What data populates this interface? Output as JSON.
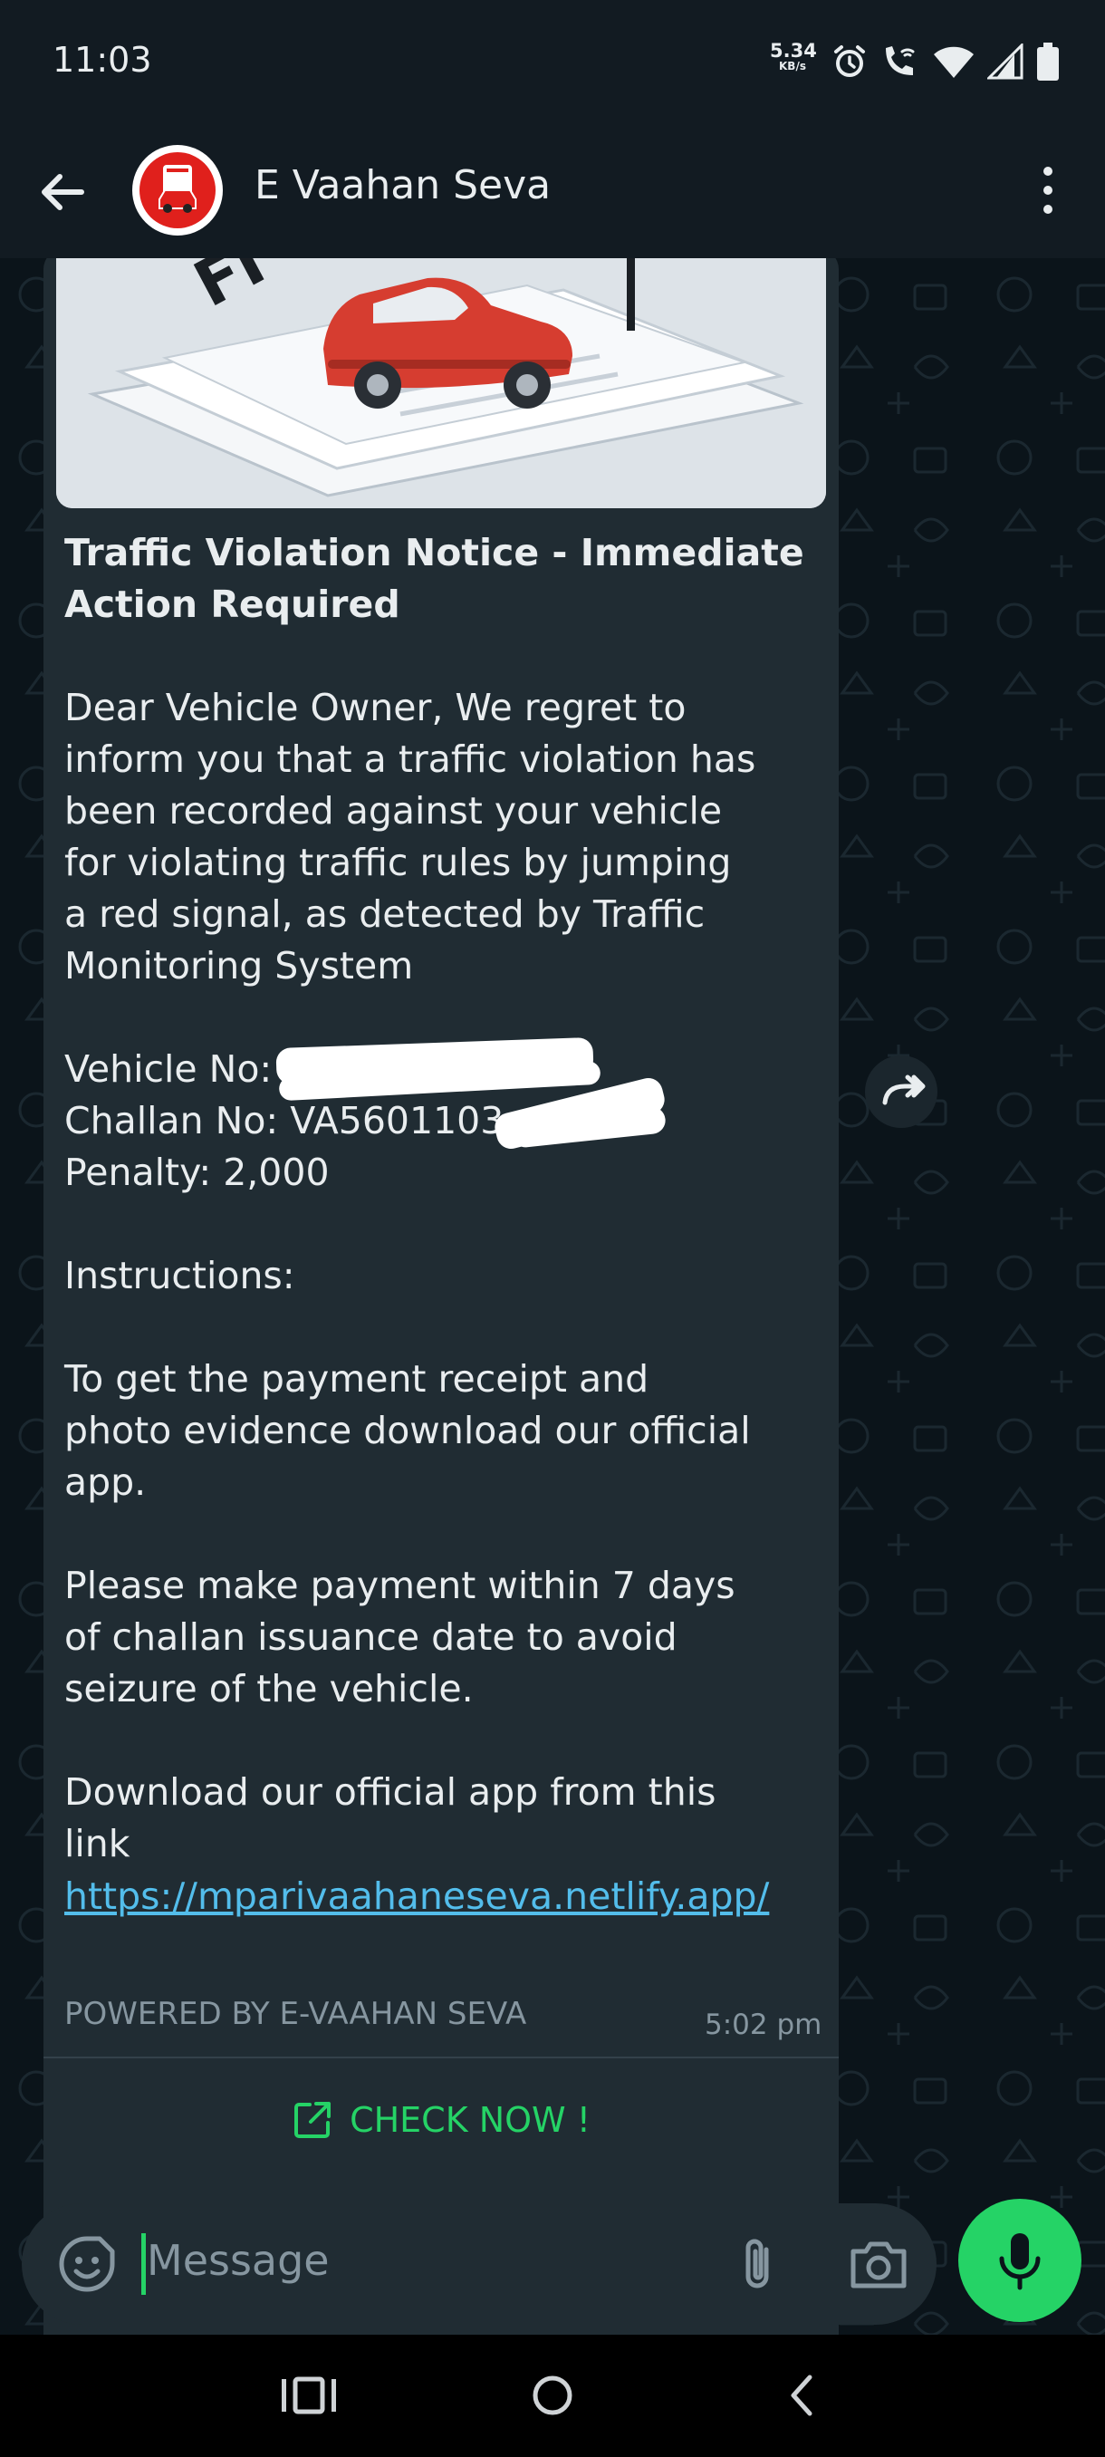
{
  "status_bar": {
    "time": "11:03",
    "speed_value": "5.34",
    "speed_unit": "KB/s",
    "icons": [
      "alarm-icon",
      "wifi-call-icon",
      "wifi-icon",
      "signal-icon",
      "battery-icon"
    ]
  },
  "app_bar": {
    "contact_name": "E Vaahan Seva",
    "back_icon": "arrow-left-icon",
    "menu_icon": "more-vertical-icon"
  },
  "message": {
    "title": "Traffic Violation Notice - Immediate Action Required",
    "intro_lines": [
      "Dear Vehicle Owner, We regret to",
      "inform you that a traffic violation has",
      "been recorded against your vehicle",
      "for violating traffic rules by jumping",
      "a red signal, as detected by Traffic",
      "Monitoring System"
    ],
    "vehicle_no": "Vehicle No: P",
    "challan_no": "Challan No: VA5601103",
    "penalty": "Penalty: 2,000",
    "instructions_heading": "Instructions:",
    "instruction_1_lines": [
      "To get the payment receipt and",
      "photo evidence download our official",
      "app."
    ],
    "instruction_2_lines": [
      "Please make payment within 7 days",
      "of challan issuance date to avoid",
      "seizure of the vehicle."
    ],
    "download_lines": [
      "Download our official app from this",
      "link"
    ],
    "link": "https://mparivaahaneseva.netlify.app/",
    "footer": "POWERED BY E-VAAHAN SEVA",
    "time": "5:02 pm",
    "button_label": "CHECK NOW !"
  },
  "input": {
    "placeholder": "Message"
  },
  "colors": {
    "accent_green": "#25d366",
    "link_blue": "#53bdeb",
    "bubble_bg": "#202c33",
    "chat_bg": "#0b141a",
    "bar_bg": "#121b22"
  }
}
